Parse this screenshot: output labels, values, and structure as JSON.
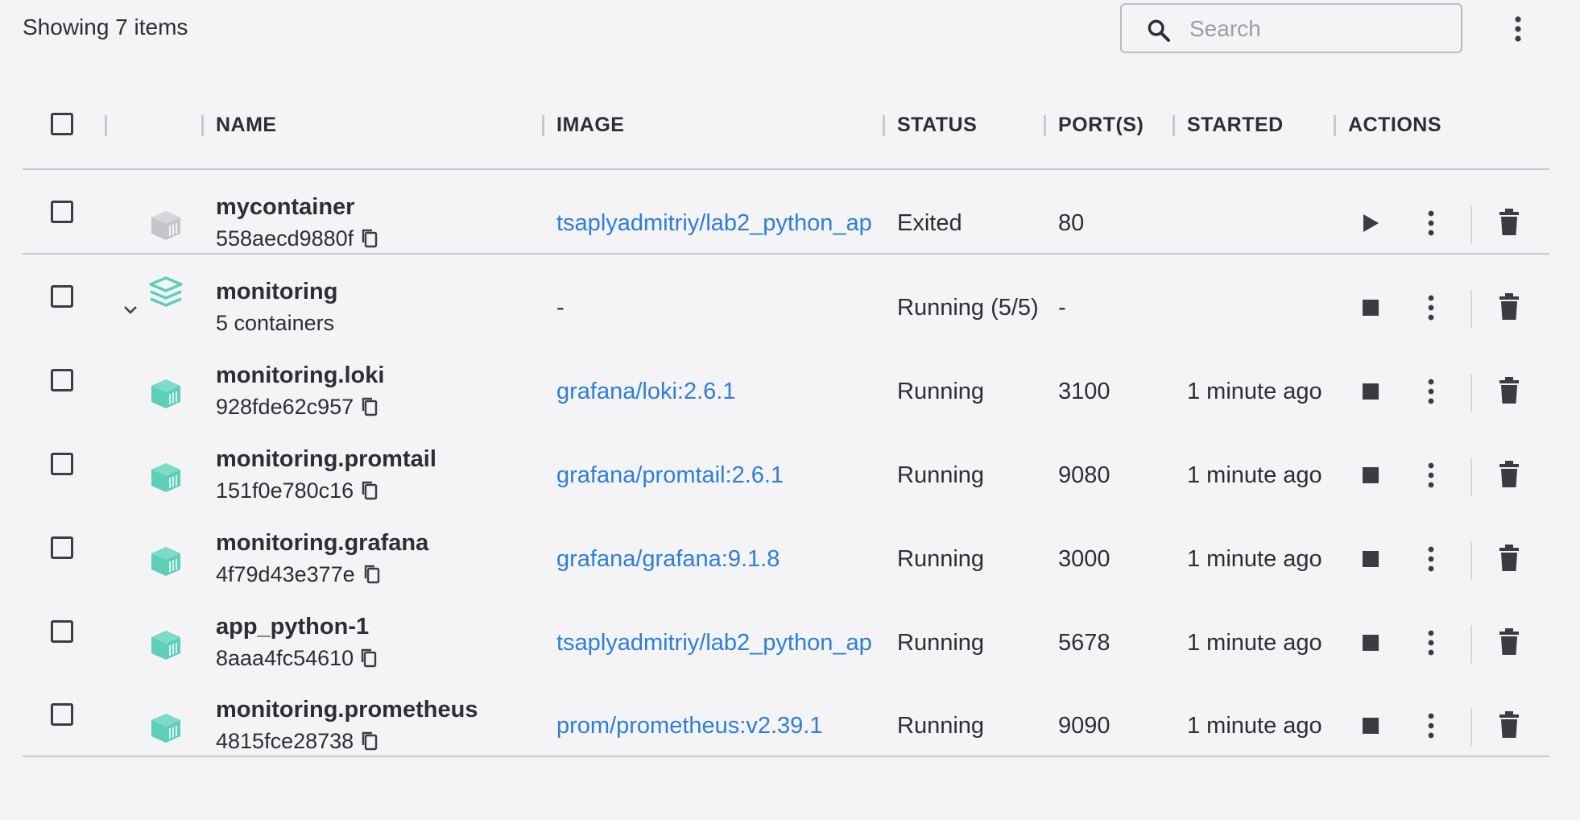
{
  "toolbar": {
    "count_text": "Showing 7 items",
    "search_placeholder": "Search"
  },
  "columns": {
    "name": "NAME",
    "image": "IMAGE",
    "status": "STATUS",
    "ports": "PORT(S)",
    "started": "STARTED",
    "actions": "ACTIONS"
  },
  "colors": {
    "link": "#2d7ed8",
    "running_icon": "#5ecfb8",
    "exited_icon": "#c3c5c9"
  },
  "rows": [
    {
      "name": "mycontainer",
      "id": "558aecd9880f",
      "image": "tsaplyadmitriy/lab2_python_ap",
      "status": "Exited",
      "ports": "80",
      "started": "",
      "icon": "container-icon-stopped",
      "action": "play"
    },
    {
      "name": "monitoring",
      "id": "5 containers",
      "image": "-",
      "status": "Running (5/5)",
      "ports": "-",
      "started": "",
      "icon": "stack-icon",
      "action": "stop"
    },
    {
      "name": "monitoring.loki",
      "id": "928fde62c957",
      "image": "grafana/loki:2.6.1",
      "status": "Running",
      "ports": "3100",
      "started": "1 minute ago",
      "icon": "container-icon-running",
      "action": "stop"
    },
    {
      "name": "monitoring.promtail",
      "id": "151f0e780c16",
      "image": "grafana/promtail:2.6.1",
      "status": "Running",
      "ports": "9080",
      "started": "1 minute ago",
      "icon": "container-icon-running",
      "action": "stop"
    },
    {
      "name": "monitoring.grafana",
      "id": "4f79d43e377e",
      "image": "grafana/grafana:9.1.8",
      "status": "Running",
      "ports": "3000",
      "started": "1 minute ago",
      "icon": "container-icon-running",
      "action": "stop"
    },
    {
      "name": "app_python-1",
      "id": "8aaa4fc54610",
      "image": "tsaplyadmitriy/lab2_python_ap",
      "status": "Running",
      "ports": "5678",
      "started": "1 minute ago",
      "icon": "container-icon-running",
      "action": "stop"
    },
    {
      "name": "monitoring.prometheus",
      "id": "4815fce28738",
      "image": "prom/prometheus:v2.39.1",
      "status": "Running",
      "ports": "9090",
      "started": "1 minute ago",
      "icon": "container-icon-running",
      "action": "stop"
    }
  ]
}
